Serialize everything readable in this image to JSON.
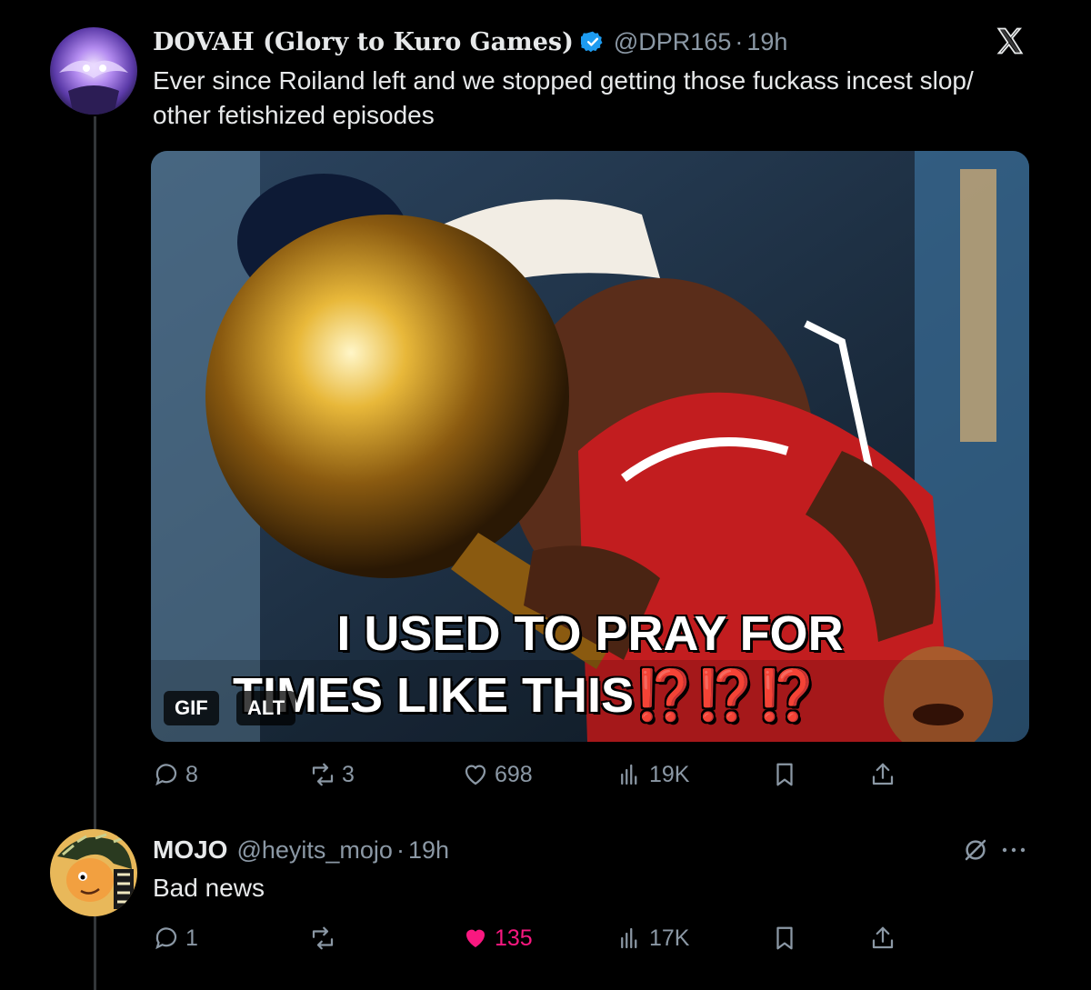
{
  "tweet1": {
    "display_name": "DOVAH (Glory to Kuro Games)",
    "handle": "@DPR165",
    "separator": "·",
    "time": "19h",
    "text": "Ever since Roiland left and we stopped getting those fuckass incest slop/ other fetishized episodes",
    "media": {
      "caption_line1": "I USED TO PRAY FOR",
      "caption_line2": "TIMES LIKE THIS",
      "caption_bangs": "⁉️⁉️⁉️",
      "gif_badge": "GIF",
      "alt_badge": "ALT"
    },
    "actions": {
      "replies": "8",
      "reposts": "3",
      "likes": "698",
      "views": "19K"
    }
  },
  "tweet2": {
    "display_name": "MOJO",
    "handle": "@heyits_mojo",
    "separator": "·",
    "time": "19h",
    "text": "Bad news",
    "actions": {
      "replies": "1",
      "reposts": "",
      "likes": "135",
      "views": "17K"
    }
  },
  "icons": {
    "header_right": "x-logo",
    "verified": "verified-badge-icon",
    "reply": "reply-icon",
    "repost": "repost-icon",
    "like": "heart-icon",
    "views": "views-icon",
    "bookmark": "bookmark-icon",
    "share": "share-icon",
    "grok": "no-entry-icon",
    "more": "more-icon"
  },
  "colors": {
    "background": "#000000",
    "text": "#e7e9ea",
    "secondary": "#8b98a5",
    "verified": "#1d9bf0",
    "like_active": "#f91880",
    "thread_line": "#333639"
  }
}
